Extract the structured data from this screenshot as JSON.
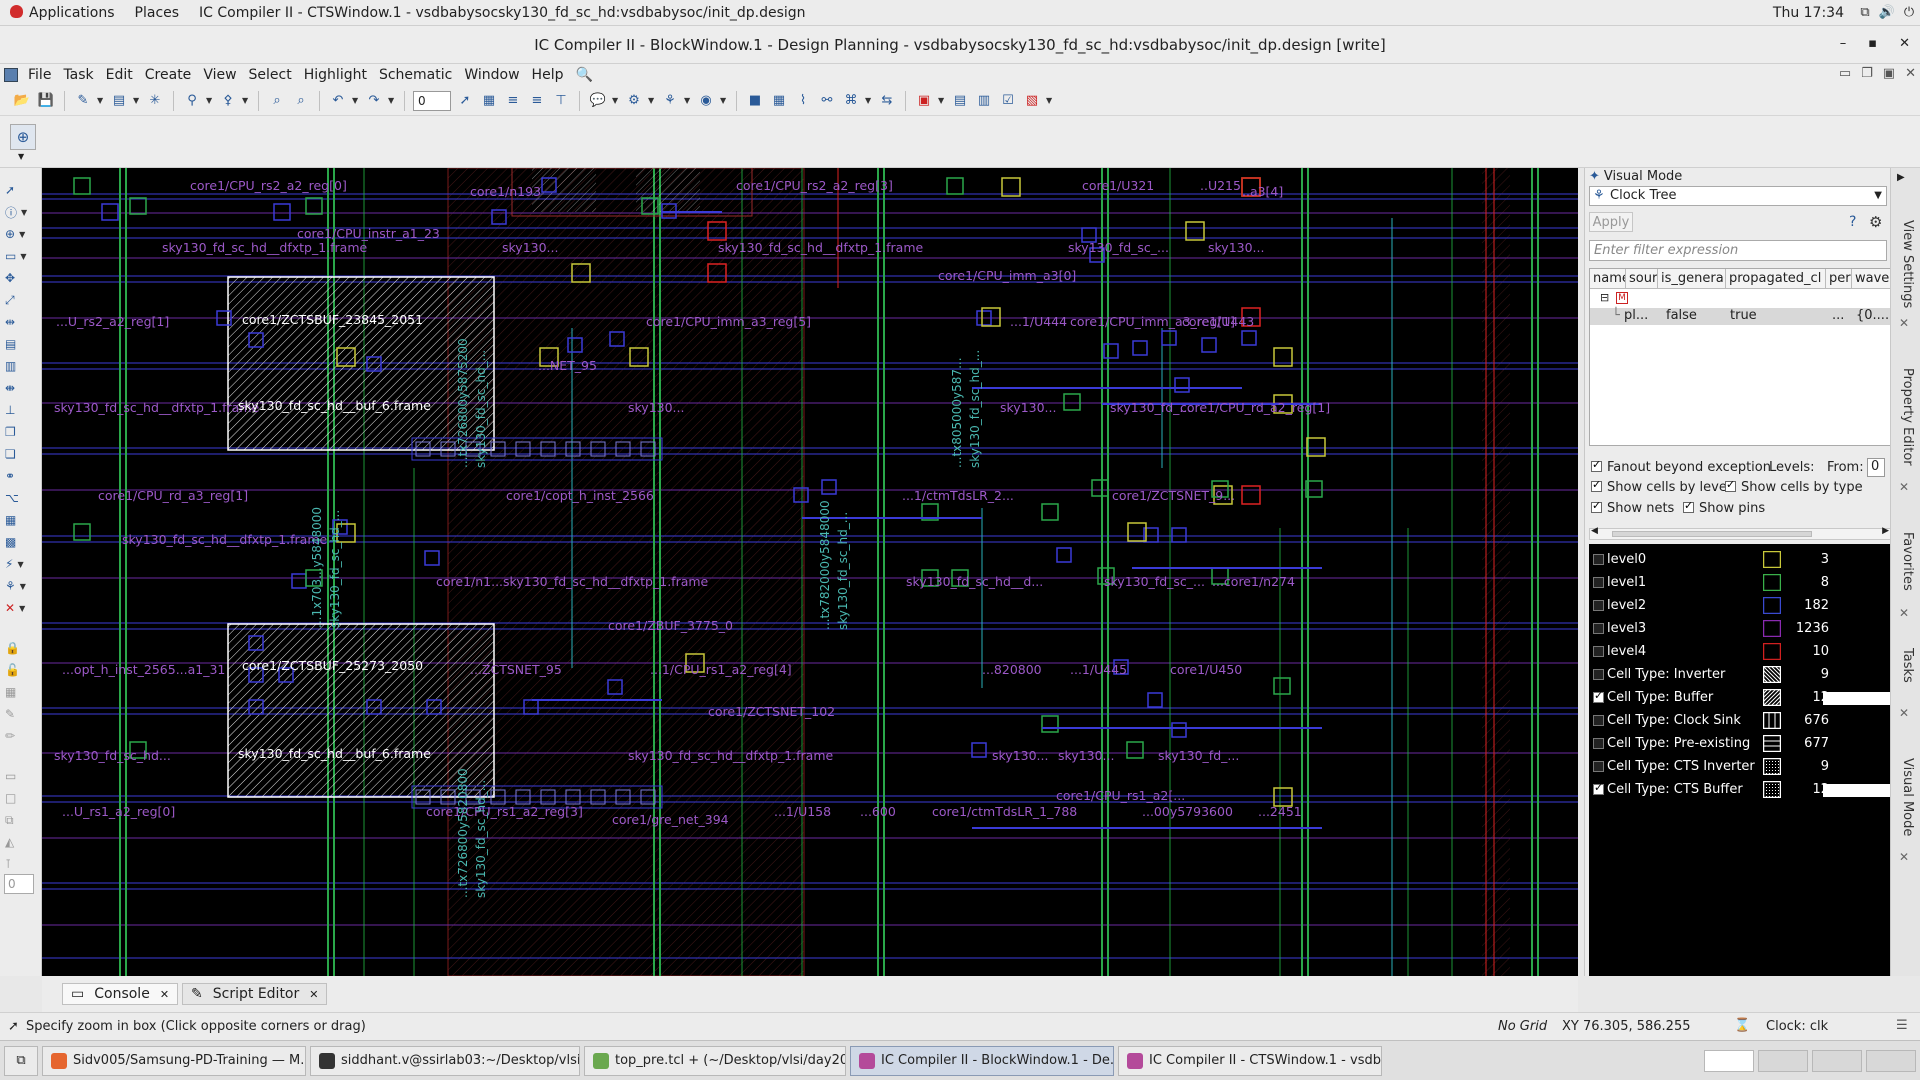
{
  "topbar": {
    "applications": "Applications",
    "places": "Places",
    "active_window": "IC Compiler II - CTSWindow.1 - vsdbabysocsky130_fd_sc_hd:vsdbabysoc/init_dp.design",
    "clock": "Thu 17:34"
  },
  "window": {
    "title": "IC Compiler II - BlockWindow.1 - Design Planning - vsdbabysocsky130_fd_sc_hd:vsdbabysoc/init_dp.design [write]",
    "minimize": "–",
    "maximize": "▪",
    "close": "✕"
  },
  "menubar": [
    "File",
    "Task",
    "Edit",
    "Create",
    "View",
    "Select",
    "Highlight",
    "Schematic",
    "Window",
    "Help"
  ],
  "toolbar": {
    "spin_value": "0"
  },
  "canvas": {
    "labels": [
      {
        "t": "core1/CPU_rs2_a2_reg[0]",
        "c": ""
      },
      {
        "t": "core1/n193",
        "c": ""
      },
      {
        "t": "core1/CPU_rs2_a2_reg[3]",
        "c": ""
      },
      {
        "t": "core1/U321",
        "c": ""
      },
      {
        "t": "..U215",
        "c": ""
      },
      {
        "t": "..a3[4]",
        "c": ""
      },
      {
        "t": "core1/CPU_instr_a1_23",
        "c": ""
      },
      {
        "t": "sky130_fd_sc_hd__dfxtp_1.frame",
        "c": ""
      },
      {
        "t": "sky130...",
        "c": ""
      },
      {
        "t": "sky130_fd_sc_hd__dfxtp_1.frame",
        "c": ""
      },
      {
        "t": "sky130_fd_sc_...",
        "c": ""
      },
      {
        "t": "sky130...",
        "c": ""
      },
      {
        "t": "core1/CPU_imm_a3[0]",
        "c": ""
      },
      {
        "t": "...U_rs2_a2_reg[1]",
        "c": ""
      },
      {
        "t": "core1/CPU_imm_a3_reg[5]",
        "c": ""
      },
      {
        "t": "...1/U444",
        "c": ""
      },
      {
        "t": "core1/CPU_imm_a3_reg[1]",
        "c": ""
      },
      {
        "t": "core1/U443",
        "c": ""
      },
      {
        "t": "...NET_95",
        "c": ""
      },
      {
        "t": "sky130_fd_sc_hd__dfxtp_1.frame",
        "c": ""
      },
      {
        "t": "sky130...",
        "c": ""
      },
      {
        "t": "sky130...",
        "c": ""
      },
      {
        "t": "sky130_fd_...",
        "c": ""
      },
      {
        "t": "core1/CPU_rd_a2_reg[1]",
        "c": ""
      },
      {
        "t": "core1/CPU_rd_a3_reg[1]",
        "c": ""
      },
      {
        "t": "core1/copt_h_inst_2566",
        "c": ""
      },
      {
        "t": "...1/ctmTdsLR_2...",
        "c": ""
      },
      {
        "t": "core1/ZCTSNET_9...",
        "c": ""
      },
      {
        "t": "sky130_fd_sc_hd__dfxtp_1.frame",
        "c": ""
      },
      {
        "t": "core1/n1...sky130_fd_sc_hd__dfxtp_1.frame",
        "c": ""
      },
      {
        "t": "sky130_fd_sc_hd__d...",
        "c": ""
      },
      {
        "t": "sky130_fd_sc_...",
        "c": ""
      },
      {
        "t": "...core1/n274",
        "c": ""
      },
      {
        "t": "core1/ZBUF_3775_0",
        "c": ""
      },
      {
        "t": "...opt_h_inst_2565...a1_31",
        "c": ""
      },
      {
        "t": "...ZCTSNET_95",
        "c": ""
      },
      {
        "t": "...1/CPU_rs1_a2_reg[4]",
        "c": ""
      },
      {
        "t": "...820800",
        "c": ""
      },
      {
        "t": "...1/U445",
        "c": ""
      },
      {
        "t": "core1/U450",
        "c": ""
      },
      {
        "t": "core1/ZCTSNET_102",
        "c": ""
      },
      {
        "t": "sky130_fd_sc_hd...",
        "c": ""
      },
      {
        "t": "sky130_fd_sc_hd__dfxtp_1.frame",
        "c": ""
      },
      {
        "t": "sky130...",
        "c": ""
      },
      {
        "t": "sky130...",
        "c": ""
      },
      {
        "t": "sky130_fd_...",
        "c": ""
      },
      {
        "t": "...U_rs1_a2_reg[0]",
        "c": ""
      },
      {
        "t": "core1/CPU_rs1_a2_reg[3]",
        "c": ""
      },
      {
        "t": "...1/U158",
        "c": ""
      },
      {
        "t": "...600",
        "c": ""
      },
      {
        "t": "core1/ctmTdsLR_1_788",
        "c": ""
      },
      {
        "t": "...00y5793600",
        "c": ""
      },
      {
        "t": "core1/CPU_rs1_a2[...",
        "c": ""
      },
      {
        "t": "...2451",
        "c": ""
      },
      {
        "t": "core1/gre_net_394",
        "c": ""
      }
    ],
    "blocks": [
      {
        "name": "core1/ZCTSBUF_23845_2051",
        "frame": "sky130_fd_sc_hd__buf_6.frame"
      },
      {
        "name": "core1/ZCTSBUF_25273_2050",
        "frame": "sky130_fd_sc_hd__buf_6.frame"
      }
    ],
    "vlabels": [
      "...tx726800y5875200",
      "sky130_fd_sc_hd_...",
      "...tx805000y587...",
      "sky130_fd_sc_hd_...",
      "...1x703...y5848000",
      "sky130_fd_sc_hd_...",
      "...tx782000y5848000",
      "sky130_fd_sc_hd_...",
      "...tx726800y5820800",
      "sky130_fd_sc_hd_..."
    ]
  },
  "visual_mode": {
    "title": "Visual Mode",
    "mode": "Clock Tree",
    "apply": "Apply",
    "filter_placeholder": "Enter filter expression",
    "columns": [
      "name",
      "sour",
      "is_genera",
      "propagated_cl",
      "per",
      "wavel"
    ],
    "row": {
      "name": "pl...",
      "is_generated": "false",
      "propagated": "true",
      "per": "...",
      "wave": "{0...."
    },
    "options": {
      "fanout": "Fanout beyond exception",
      "levels": "Levels:",
      "from": "From:",
      "from_value": "0",
      "show_cells_by_level": "Show cells by level",
      "show_cells_by_type": "Show cells by type",
      "show_nets": "Show nets",
      "show_pins": "Show pins"
    },
    "levels": [
      {
        "label": "level0",
        "count": "3",
        "color": "#c8c83a",
        "pattern": "solid",
        "checked": false,
        "white": false
      },
      {
        "label": "level1",
        "count": "8",
        "color": "#3ab04a",
        "pattern": "solid",
        "checked": false,
        "white": false
      },
      {
        "label": "level2",
        "count": "182",
        "color": "#3a4ad0",
        "pattern": "solid",
        "checked": false,
        "white": false
      },
      {
        "label": "level3",
        "count": "1236",
        "color": "#8a2ab0",
        "pattern": "solid",
        "checked": false,
        "white": false
      },
      {
        "label": "level4",
        "count": "10",
        "color": "#d02020",
        "pattern": "solid",
        "checked": false,
        "white": false
      },
      {
        "label": "Cell Type: Inverter",
        "count": "9",
        "color": "#ffffff",
        "pattern": "diag-back",
        "checked": false,
        "white": false
      },
      {
        "label": "Cell Type: Buffer",
        "count": "12",
        "color": "#ffffff",
        "pattern": "diag",
        "checked": true,
        "white": true
      },
      {
        "label": "Cell Type: Clock Sink",
        "count": "676",
        "color": "#ffffff",
        "pattern": "vert",
        "checked": false,
        "white": false
      },
      {
        "label": "Cell Type: Pre-existing",
        "count": "677",
        "color": "#ffffff",
        "pattern": "horiz",
        "checked": false,
        "white": false
      },
      {
        "label": "Cell Type: CTS Inverter",
        "count": "9",
        "color": "#ffffff",
        "pattern": "dots",
        "checked": false,
        "white": false
      },
      {
        "label": "Cell Type: CTS Buffer",
        "count": "12",
        "color": "#ffffff",
        "pattern": "dots",
        "checked": true,
        "white": true
      }
    ]
  },
  "side_tabs": [
    "View Settings",
    "Property Editor",
    "Favorites",
    "Tasks",
    "Visual Mode"
  ],
  "bottom_tabs": [
    "Console",
    "Script Editor"
  ],
  "status": {
    "message": "Specify zoom in box (Click opposite corners or drag)",
    "grid": "No Grid",
    "xy": "XY 76.305, 586.255",
    "clock": "Clock: clk",
    "small_field": "0"
  },
  "taskbar": [
    {
      "label": "Sidv005/Samsung-PD-Training — M...",
      "icon": "#e5652e",
      "active": false
    },
    {
      "label": "siddhant.v@ssirlab03:~/Desktop/vlsi...",
      "icon": "#333333",
      "active": false
    },
    {
      "label": "top_pre.tcl + (~/Desktop/vlsi/day20...",
      "icon": "#6aa84f",
      "active": false
    },
    {
      "label": "IC Compiler II - BlockWindow.1 - De...",
      "icon": "#b44a9a",
      "active": true
    },
    {
      "label": "IC Compiler II - CTSWindow.1 - vsdb...",
      "icon": "#b44a9a",
      "active": false
    }
  ]
}
